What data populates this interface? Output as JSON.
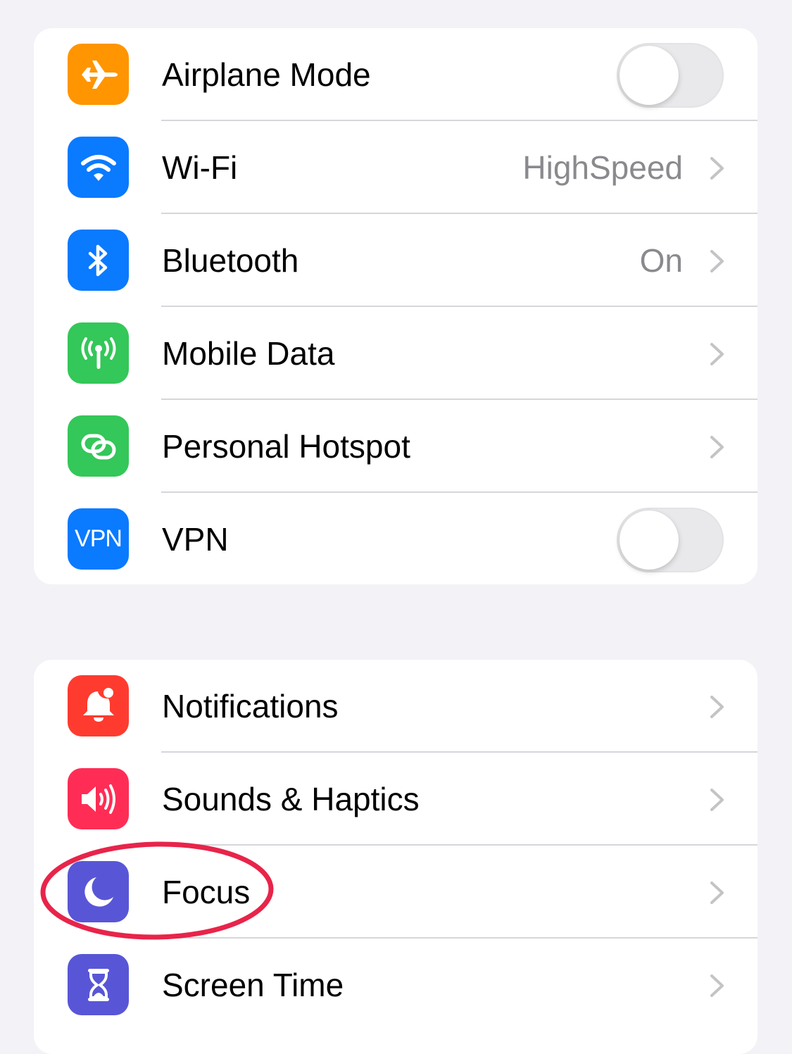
{
  "colors": {
    "background": "#f2f2f7",
    "airplane": "#ff9500",
    "wifi": "#0a7aff",
    "bluetooth": "#0a7aff",
    "mobile_data": "#34c759",
    "hotspot": "#34c759",
    "vpn": "#0a7aff",
    "notifications": "#ff3b30",
    "sounds": "#ff2d55",
    "focus": "#5856d6",
    "screen_time": "#5856d6",
    "annotation": "#e8244a"
  },
  "groups": [
    {
      "rows": [
        {
          "label": "Airplane Mode",
          "icon": "airplane-icon",
          "accessory": "toggle",
          "toggle_on": false
        },
        {
          "label": "Wi-Fi",
          "icon": "wifi-icon",
          "accessory": "chevron",
          "value": "HighSpeed"
        },
        {
          "label": "Bluetooth",
          "icon": "bluetooth-icon",
          "accessory": "chevron",
          "value": "On"
        },
        {
          "label": "Mobile Data",
          "icon": "antenna-icon",
          "accessory": "chevron"
        },
        {
          "label": "Personal Hotspot",
          "icon": "link-icon",
          "accessory": "chevron"
        },
        {
          "label": "VPN",
          "icon": "vpn-icon",
          "icon_text": "VPN",
          "accessory": "toggle",
          "toggle_on": false
        }
      ]
    },
    {
      "rows": [
        {
          "label": "Notifications",
          "icon": "bell-icon",
          "accessory": "chevron"
        },
        {
          "label": "Sounds & Haptics",
          "icon": "speaker-icon",
          "accessory": "chevron"
        },
        {
          "label": "Focus",
          "icon": "moon-icon",
          "accessory": "chevron",
          "highlighted": true
        },
        {
          "label": "Screen Time",
          "icon": "hourglass-icon",
          "accessory": "chevron"
        }
      ]
    }
  ]
}
